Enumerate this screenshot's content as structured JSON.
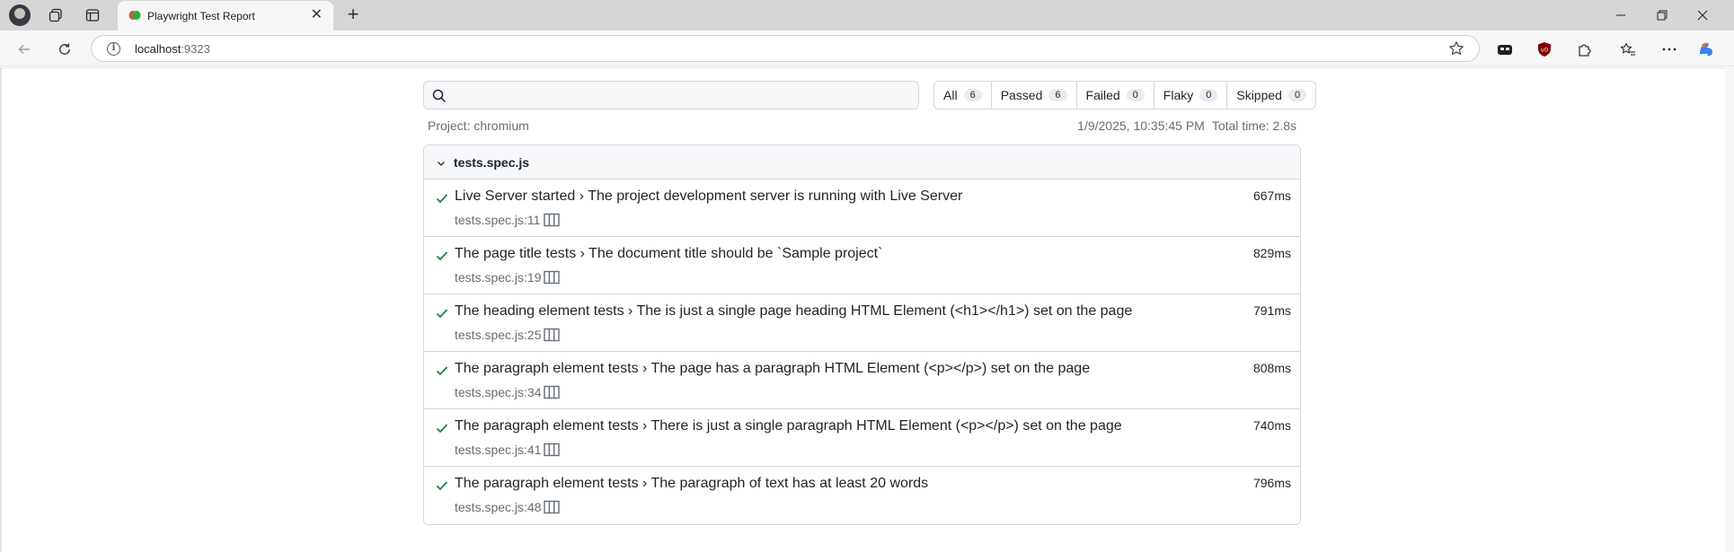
{
  "browser": {
    "tab_title": "Playwright Test Report",
    "tab_close": "✕",
    "new_tab": "+",
    "url_host": "localhost",
    "url_port": ":9323",
    "info_glyph": "i"
  },
  "report": {
    "search_placeholder": "",
    "filters": [
      {
        "label": "All",
        "count": "6"
      },
      {
        "label": "Passed",
        "count": "6"
      },
      {
        "label": "Failed",
        "count": "0"
      },
      {
        "label": "Flaky",
        "count": "0"
      },
      {
        "label": "Skipped",
        "count": "0"
      }
    ],
    "project": "Project: chromium",
    "timestamp": "1/9/2025, 10:35:45 PM",
    "total_time": "Total time: 2.8s",
    "suite_file": "tests.spec.js",
    "tests": [
      {
        "title": "Live Server started › The project development server is running with Live Server",
        "location": "tests.spec.js:11",
        "duration": "667ms",
        "status": "passed"
      },
      {
        "title": "The page title tests › The document title should be `Sample project`",
        "location": "tests.spec.js:19",
        "duration": "829ms",
        "status": "passed"
      },
      {
        "title": "The heading element tests › The is just a single page heading HTML Element (<h1></h1>) set on the page",
        "location": "tests.spec.js:25",
        "duration": "791ms",
        "status": "passed"
      },
      {
        "title": "The paragraph element tests › The page has a paragraph HTML Element (<p></p>) set on the page",
        "location": "tests.spec.js:34",
        "duration": "808ms",
        "status": "passed"
      },
      {
        "title": "The paragraph element tests › There is just a single paragraph HTML Element (<p></p>) set on the page",
        "location": "tests.spec.js:41",
        "duration": "740ms",
        "status": "passed"
      },
      {
        "title": "The paragraph element tests › The paragraph of text has at least 20 words",
        "location": "tests.spec.js:48",
        "duration": "796ms",
        "status": "passed"
      }
    ]
  },
  "colors": {
    "pass_green": "#1a7f37",
    "muted_text": "#656d76",
    "border": "#d0d7de"
  }
}
